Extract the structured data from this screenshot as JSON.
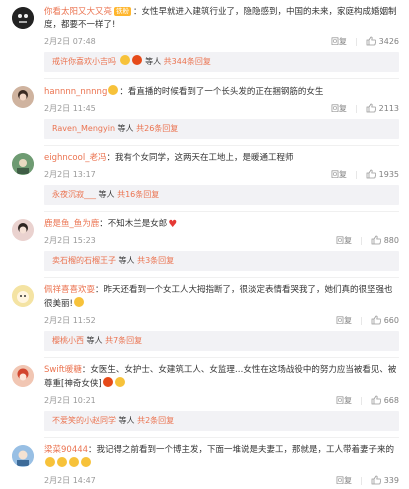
{
  "comments": [
    {
      "username": "你看太阳又大又亮",
      "badge": "铁粉",
      "content": "：女性早就进入建筑行业了，隐隐感到，中国的未来，家庭构成婚姻制度，都要不一样了!",
      "date": "2月2日 07:48",
      "reply_label": "回复",
      "likes": "3426",
      "sub": {
        "name": "戒许你喜欢小吉吗",
        "mid": " 等人 ",
        "more": "共344条回复"
      }
    },
    {
      "username": "hannnn_nnnng",
      "content": "：看直播的时候看到了一个长头发的正在捆钢筋的女生",
      "date": "2月2日 11:45",
      "reply_label": "回复",
      "likes": "2113",
      "sub": {
        "name": "Raven_Mengyin",
        "mid": " 等人 ",
        "more": "共26条回复"
      }
    },
    {
      "username": "eighncool_老冯",
      "content": "：我有个女同学，这两天在工地上，是暖通工程师",
      "date": "2月2日 13:17",
      "reply_label": "回复",
      "likes": "1935",
      "sub": {
        "name": "永夜沉寂___",
        "mid": " 等人 ",
        "more": "共16条回复"
      }
    },
    {
      "username": "鹿是鱼_鱼为鹿",
      "content": "：不知木兰是女郎",
      "date": "2月2日 15:23",
      "reply_label": "回复",
      "likes": "880",
      "sub": {
        "name": "卖石榴的石榴王子",
        "mid": " 等人 ",
        "more": "共3条回复"
      }
    },
    {
      "username": "佩祥喜喜欢耍",
      "content": "：昨天还看到一个女工人大拇指断了，很淡定表情看哭我了，她们真的很坚强也很美丽!",
      "date": "2月2日 11:52",
      "reply_label": "回复",
      "likes": "660",
      "sub": {
        "name": "樱桃小西",
        "mid": " 等人 ",
        "more": "共7条回复"
      }
    },
    {
      "username": "Swift暖糖",
      "content": "：女医生、女护士、女建筑工人、女监理…女性在这场战役中的努力应当被看见、被尊重[神奇女侠]",
      "date": "2月2日 10:21",
      "reply_label": "回复",
      "likes": "668",
      "sub": {
        "name": "不爱笑的小赵同学",
        "mid": " 等人 ",
        "more": "共2条回复"
      }
    },
    {
      "username": "梁菜90444",
      "content": "：我记得之前看到一个博主发，下面一堆说是夫妻工，那就是，工人带着妻子来的",
      "date": "2月2日 14:47",
      "reply_label": "回复",
      "likes": "339"
    }
  ],
  "colors": {
    "accent": "#eb7350",
    "reply_bg": "#f2f2f5"
  },
  "icons": {
    "like": "thumb-up-icon"
  }
}
